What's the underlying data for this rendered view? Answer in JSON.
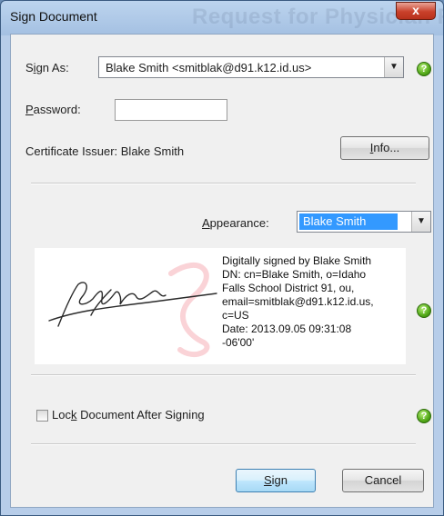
{
  "window": {
    "title": "Sign Document",
    "background_title": "Request for Physician Refe",
    "close_glyph": "x"
  },
  "sign_as": {
    "label_prefix": "S",
    "label_accel": "i",
    "label_suffix": "gn As:",
    "selected": "Blake Smith <smitblak@d91.k12.id.us>"
  },
  "password": {
    "label_accel": "P",
    "label_suffix": "assword:",
    "value": ""
  },
  "certificate": {
    "issuer_text": "Certificate Issuer: Blake Smith",
    "info_button_accel": "I",
    "info_button_suffix": "nfo..."
  },
  "appearance": {
    "label_accel": "A",
    "label_suffix": "ppearance:",
    "selected": "Blake Smith"
  },
  "preview": {
    "signature_text": "Digitally signed by Blake Smith\nDN: cn=Blake Smith, o=Idaho\nFalls School District 91, ou,\nemail=smitblak@d91.k12.id.us,\nc=US\nDate: 2013.09.05 09:31:08\n-06'00'"
  },
  "lock": {
    "label_prefix": "Loc",
    "label_accel": "k",
    "label_suffix": " Document After Signing",
    "checked": false
  },
  "buttons": {
    "sign_accel": "S",
    "sign_suffix": "ign",
    "cancel": "Cancel"
  },
  "help_glyph": "?",
  "dropdown_glyph": "▼",
  "colors": {
    "help_icon": "#52a818",
    "selection": "#3399ff",
    "watermark_icon": "#e8364a",
    "close_button": "#c9412b"
  }
}
